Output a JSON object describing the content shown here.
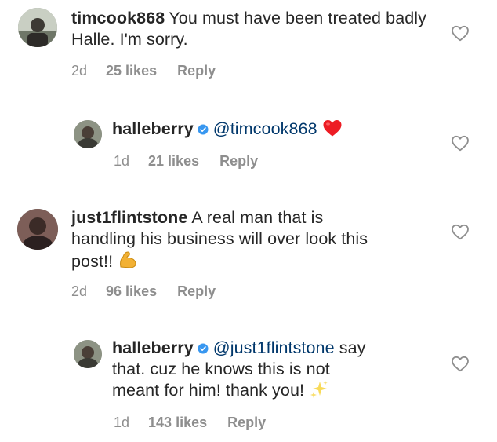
{
  "comments": [
    {
      "username": "timcook868",
      "text": "You must have been treated badly Halle. I'm sorry.",
      "age": "2d",
      "likes": "25 likes",
      "reply": "Reply",
      "avatar_color": "#7f8a7a"
    },
    {
      "username": "halleberry",
      "verified": true,
      "mention": "@timcook868",
      "text": "",
      "emoji": "red-heart",
      "age": "1d",
      "likes": "21 likes",
      "reply": "Reply",
      "avatar_color": "#6d7463"
    },
    {
      "username": "just1flintstone",
      "text_line1": "A real man that is",
      "text_line2": "handling his business will over look this",
      "text_line3": "post!!",
      "emoji": "flexed-biceps",
      "age": "2d",
      "likes": "96 likes",
      "reply": "Reply",
      "avatar_color": "#5a4a48"
    },
    {
      "username": "halleberry",
      "verified": true,
      "mention": "@just1flintstone",
      "text_line1": "say",
      "text_line2": "that.  cuz he knows this is not",
      "text_line3": "meant for him!  thank you!",
      "emoji": "sparkles",
      "age": "1d",
      "likes": "143 likes",
      "reply": "Reply",
      "avatar_color": "#6d7463"
    }
  ],
  "colors": {
    "text": "#262626",
    "meta": "#8e8e8e",
    "mention": "#00376b",
    "verified": "#3897f0",
    "heart": "#ed1c24"
  },
  "icons": {
    "like": "heart-outline-icon",
    "verified": "verified-badge-icon"
  }
}
